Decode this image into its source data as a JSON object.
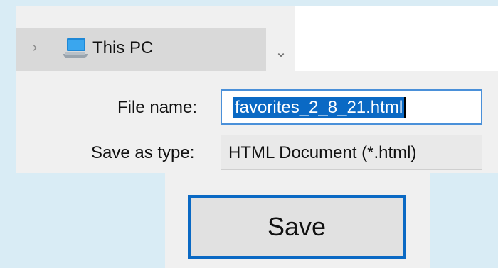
{
  "nav": {
    "expand_icon": "chevron-right-icon",
    "item_icon": "computer-icon",
    "item_label": "This PC",
    "dropdown_icon": "chevron-down-icon"
  },
  "form": {
    "filename_label": "File name:",
    "filename_value": "favorites_2_8_21.html",
    "type_label": "Save as type:",
    "type_value": "HTML Document (*.html)"
  },
  "buttons": {
    "save_label": "Save"
  },
  "colors": {
    "background": "#d9ecf5",
    "dialog": "#f0f0f0",
    "selection": "#0a69c4",
    "focus_border": "#0a69c4"
  }
}
